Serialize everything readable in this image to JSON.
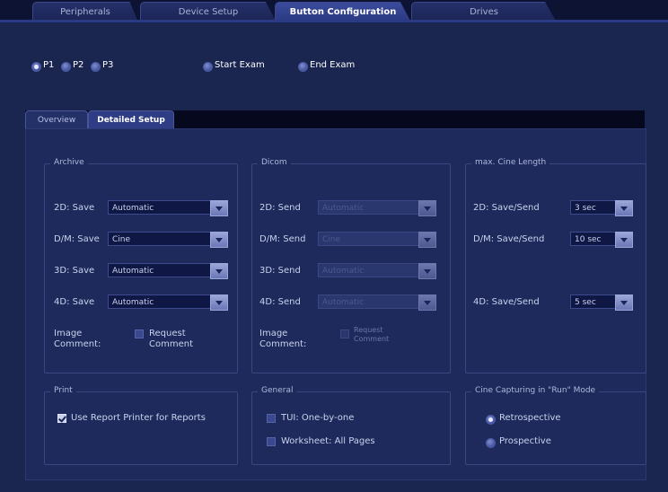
{
  "top_tabs": [
    {
      "label": "Peripherals",
      "active": false
    },
    {
      "label": "Device Setup",
      "active": false
    },
    {
      "label": "Button Configuration",
      "active": true
    },
    {
      "label": "Drives",
      "active": false
    }
  ],
  "p_buttons": [
    {
      "label": "P1",
      "selected": true
    },
    {
      "label": "P2",
      "selected": false
    },
    {
      "label": "P3",
      "selected": false
    }
  ],
  "exam_options": [
    {
      "label": "Start Exam",
      "selected": false
    },
    {
      "label": "End Exam",
      "selected": false
    }
  ],
  "sub_tabs": [
    {
      "label": "Overview",
      "active": false
    },
    {
      "label": "Detailed Setup",
      "active": true
    }
  ],
  "archive": {
    "title": "Archive",
    "rows": [
      {
        "label": "2D: Save",
        "value": "Automatic"
      },
      {
        "label": "D/M: Save",
        "value": "Cine"
      },
      {
        "label": "3D: Save",
        "value": "Automatic"
      },
      {
        "label": "4D: Save",
        "value": "Automatic"
      }
    ],
    "image_comment_label_1": "Image",
    "image_comment_label_2": "Comment:",
    "request_comment_1": "Request",
    "request_comment_2": "Comment"
  },
  "dicom": {
    "title": "Dicom",
    "rows": [
      {
        "label": "2D: Send",
        "value": "Automatic"
      },
      {
        "label": "D/M: Send",
        "value": "Cine"
      },
      {
        "label": "3D: Send",
        "value": "Automatic"
      },
      {
        "label": "4D: Send",
        "value": "Automatic"
      }
    ],
    "image_comment_label_1": "Image",
    "image_comment_label_2": "Comment:",
    "request_comment_1": "Request",
    "request_comment_2": "Comment"
  },
  "cine_length": {
    "title": "max. Cine Length",
    "rows": [
      {
        "label": "2D: Save/Send",
        "value": "3 sec"
      },
      {
        "label": "D/M: Save/Send",
        "value": "10 sec"
      },
      {
        "label": "4D: Save/Send",
        "value": "5 sec"
      }
    ]
  },
  "print": {
    "title": "Print",
    "use_report_printer": "Use Report Printer for Reports",
    "use_report_printer_checked": true
  },
  "general": {
    "title": "General",
    "items": [
      {
        "label": "TUI: One-by-one",
        "checked": false
      },
      {
        "label": "Worksheet: All Pages",
        "checked": false
      }
    ]
  },
  "cine_capture": {
    "title": "Cine Capturing in \"Run\" Mode",
    "options": [
      {
        "label": "Retrospective",
        "selected": true
      },
      {
        "label": "Prospective",
        "selected": false
      }
    ]
  }
}
